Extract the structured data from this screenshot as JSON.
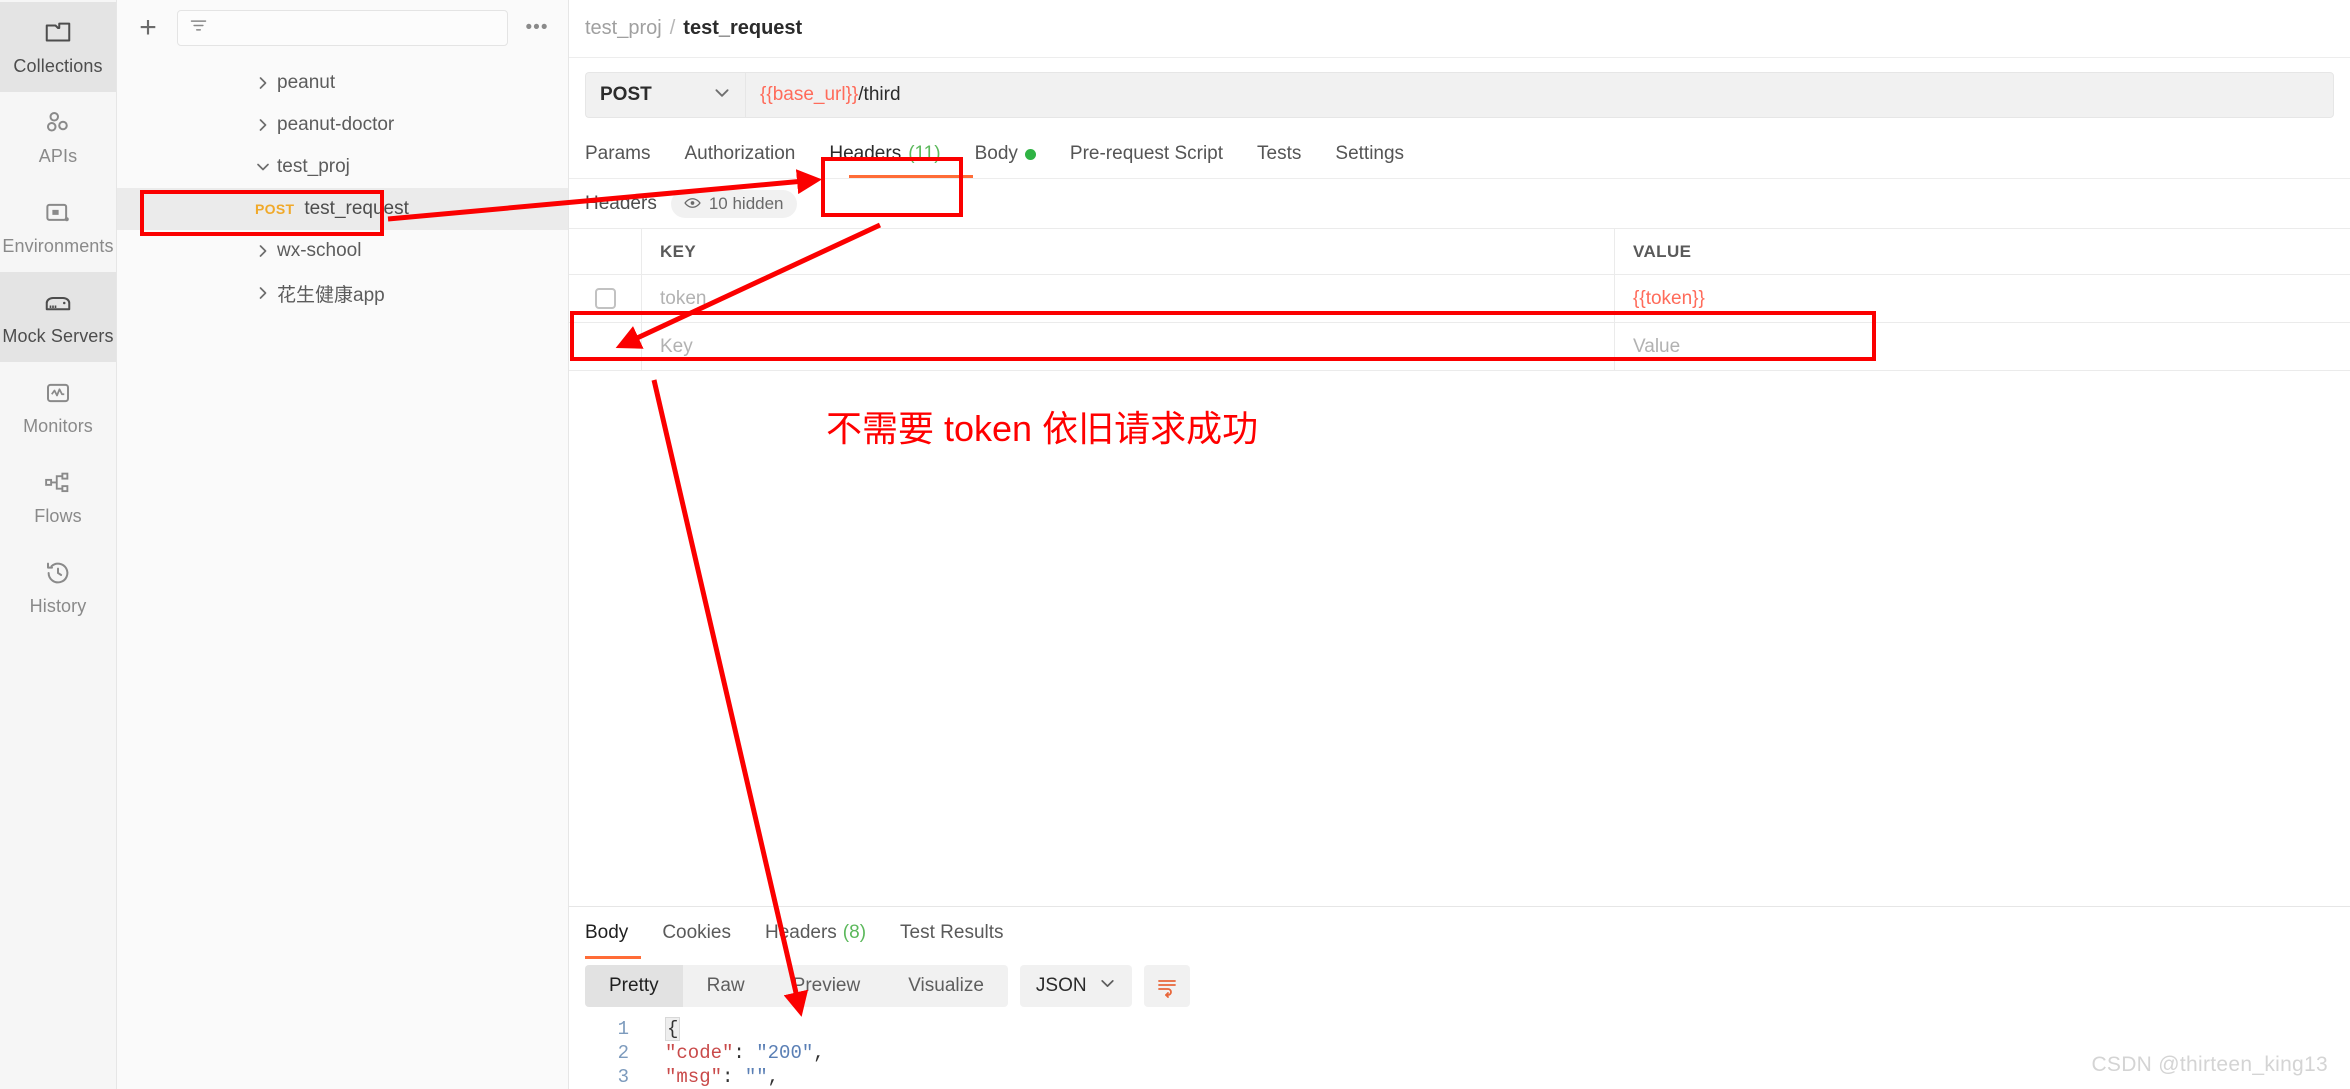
{
  "rail": {
    "items": [
      {
        "label": "Collections",
        "icon": "collections-icon",
        "active": true
      },
      {
        "label": "APIs",
        "icon": "apis-icon",
        "active": false
      },
      {
        "label": "Environments",
        "icon": "environments-icon",
        "active": false
      },
      {
        "label": "Mock Servers",
        "icon": "mock-servers-icon",
        "active": true
      },
      {
        "label": "Monitors",
        "icon": "monitors-icon",
        "active": false
      },
      {
        "label": "Flows",
        "icon": "flows-icon",
        "active": false
      },
      {
        "label": "History",
        "icon": "history-icon",
        "active": false
      }
    ]
  },
  "sidebar": {
    "new_button": "+",
    "filter_placeholder": "",
    "filter_icon": "filter-icon",
    "more_actions": "•••",
    "tree": [
      {
        "name": "peanut",
        "type": "collection",
        "expanded": false
      },
      {
        "name": "peanut-doctor",
        "type": "collection",
        "expanded": false
      },
      {
        "name": "test_proj",
        "type": "collection",
        "expanded": true
      },
      {
        "name": "test_request",
        "type": "request",
        "method": "POST",
        "selected": true
      },
      {
        "name": "wx-school",
        "type": "collection",
        "expanded": false
      },
      {
        "name": "花生健康app",
        "type": "collection",
        "expanded": false
      }
    ]
  },
  "breadcrumb": {
    "parent": "test_proj",
    "separator": "/",
    "current": "test_request"
  },
  "url_bar": {
    "method": "POST",
    "url_variable": "{{base_url}}",
    "url_path": "/third"
  },
  "request_tabs": [
    {
      "label": "Params",
      "active": false
    },
    {
      "label": "Authorization",
      "active": false
    },
    {
      "label": "Headers",
      "count": "(11)",
      "active": true
    },
    {
      "label": "Body",
      "dot": true,
      "active": false
    },
    {
      "label": "Pre-request Script",
      "active": false
    },
    {
      "label": "Tests",
      "active": false
    },
    {
      "label": "Settings",
      "active": false
    }
  ],
  "headers_section": {
    "title": "Headers",
    "hidden_label": "10 hidden",
    "eye_icon": "eye-icon",
    "columns": [
      "KEY",
      "VALUE"
    ],
    "rows": [
      {
        "checked": false,
        "key": "token",
        "value": "{{token}}",
        "value_is_variable": true,
        "highlighted": true
      },
      {
        "checked": false,
        "key": "Key",
        "value": "Value",
        "placeholder": true
      }
    ]
  },
  "response": {
    "tabs": [
      {
        "label": "Body",
        "active": true
      },
      {
        "label": "Cookies",
        "active": false
      },
      {
        "label": "Headers",
        "count": "(8)",
        "active": false
      },
      {
        "label": "Test Results",
        "active": false
      }
    ],
    "view_modes": [
      {
        "label": "Pretty",
        "active": true
      },
      {
        "label": "Raw",
        "active": false
      },
      {
        "label": "Preview",
        "active": false
      },
      {
        "label": "Visualize",
        "active": false
      }
    ],
    "format": "JSON",
    "wrap_icon": "word-wrap-icon",
    "body_lines": [
      {
        "no": "1",
        "text": "{"
      },
      {
        "no": "2",
        "key": "\"code\"",
        "sep": ": ",
        "val": "\"200\"",
        "tail": ","
      },
      {
        "no": "3",
        "key": "\"msg\"",
        "sep": ": ",
        "val": "\"\"",
        "tail": ","
      }
    ]
  },
  "annotations": {
    "note_text": "不需要 token 依旧请求成功",
    "color": "#ff0000"
  },
  "watermark": "CSDN @thirteen_king13"
}
